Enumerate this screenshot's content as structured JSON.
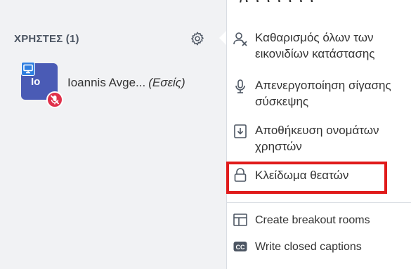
{
  "users_panel": {
    "title": "ΧΡΗΣΤΕΣ (1)",
    "settings_icon": "gear-icon"
  },
  "user": {
    "initials": "Io",
    "name": "Ioannis Avge...",
    "you_label": "(Εσείς)",
    "avatar_color": "#4a5bb5",
    "presenter_icon": "presenter-icon",
    "muted_icon": "microphone-muted-icon"
  },
  "menu": {
    "partial_top_text": "/ι ι ι ι ι ι ι",
    "items": [
      {
        "icon": "clear-status-icon",
        "label": "Καθαρισμός όλων των εικονιδίων κατάστασης"
      },
      {
        "icon": "microphone-icon",
        "label": "Απενεργοποίηση σίγασης σύσκεψης"
      },
      {
        "icon": "save-download-icon",
        "label": "Αποθήκευση ονομάτων χρηστών"
      },
      {
        "icon": "lock-icon",
        "label": "Κλείδωμα θεατών"
      },
      {
        "icon": "breakout-rooms-icon",
        "label": "Create breakout rooms"
      },
      {
        "icon": "closed-captions-icon",
        "label": "Write closed captions"
      }
    ]
  },
  "highlight_color": "#e01b1b"
}
